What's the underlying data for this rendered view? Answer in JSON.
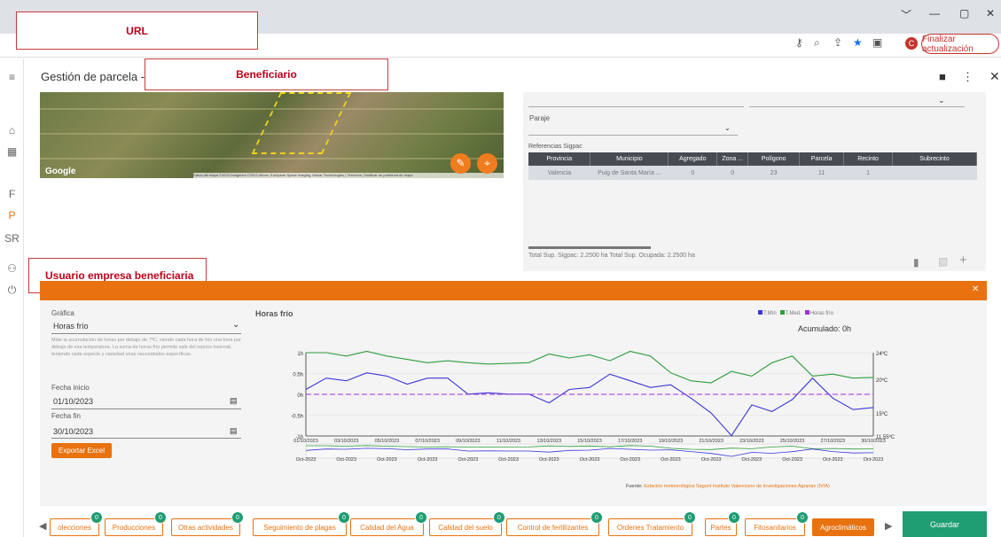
{
  "annotations": {
    "url": "URL",
    "beneficiario": "Beneficiario",
    "usuario": "Usuario empresa beneficiaria"
  },
  "browser": {
    "update_button": "Finalizar actualización",
    "avatar_letter": "C"
  },
  "leftnav": {
    "items": [
      "F",
      "P",
      "SR"
    ]
  },
  "app": {
    "title": "Gestión de parcela -"
  },
  "map": {
    "google": "Google",
    "attribution": "Datos del mapa ©2023 Imágenes ©2023 Airbus, European Space Imaging, Maxar Technologies | Términos | Notificar un problema de maps"
  },
  "right": {
    "paraje_label": "Paraje",
    "ref_label": "Referencias Sigpac",
    "columns": [
      "Provincia",
      "Municipio",
      "Agregado",
      "Zona ...",
      "Polígono",
      "Parcela",
      "Recinto",
      "Subrecinto"
    ],
    "row": [
      "Valencia",
      "Puig de Santa María ...",
      "0",
      "0",
      "23",
      "11",
      "1",
      ""
    ],
    "summary": "Total Sup. Sigpac: 2.2500 ha   Total Sup. Ocupada: 2.2500 ha"
  },
  "form": {
    "grafica_label": "Gráfica",
    "grafica_value": "Horas frío",
    "description": "Mide la acumulación de horas por debajo de 7ºC, siendo cada hora de frío una hora por debajo de esa temperatura. La suma de horas frío permite salir del reposo invernal, teniendo cada especie y variedad unas necesidades específicas.",
    "inicio_label": "Fecha inicio",
    "inicio_value": "01/10/2023",
    "fin_label": "Fecha fin",
    "fin_value": "30/10/2023",
    "export_label": "Exportar Excel"
  },
  "chart_data": {
    "type": "line",
    "title": "Horas frío",
    "accumulated": "Acumulado: 0h",
    "legend": [
      {
        "name": "T.Mín",
        "color": "#3a36d8"
      },
      {
        "name": "T.Med.",
        "color": "#2e9d3b"
      },
      {
        "name": "Horas frío",
        "color": "#a42fd6"
      }
    ],
    "y_left_ticks": [
      "1h",
      "0.5h",
      "0h",
      "-0.5h",
      "-1h"
    ],
    "y_left_range": [
      -1,
      1
    ],
    "y_right_ticks": [
      "24ºC",
      "20ºC",
      "15ºC",
      "11.55ºC"
    ],
    "y_right_range": [
      11.55,
      24
    ],
    "x_ticks": [
      "01/10/2023",
      "03/10/2023",
      "05/10/2023",
      "07/10/2023",
      "09/10/2023",
      "11/10/2023",
      "13/10/2023",
      "15/10/2023",
      "17/10/2023",
      "19/10/2023",
      "21/10/2023",
      "23/10/2023",
      "25/10/2023",
      "27/10/2023",
      "30/10/2023"
    ],
    "nav_ticks": [
      "Oct-2023",
      "Oct-2023",
      "Oct-2023",
      "Oct-2023",
      "Oct-2023",
      "Oct-2023",
      "Oct-2023",
      "Oct-2023",
      "Oct-2023",
      "Oct-2023",
      "Oct-2023",
      "Oct-2023",
      "Oct-2023",
      "Oct-2023",
      "Oct-2023"
    ],
    "series": [
      {
        "name": "T.Med.",
        "values": [
          24,
          24,
          23.5,
          24.2,
          23.5,
          23,
          22.5,
          22.8,
          22.5,
          22.3,
          22.4,
          22.5,
          23.8,
          23.2,
          23.7,
          22.8,
          24.2,
          23.5,
          21,
          19.8,
          19.5,
          21.2,
          20.5,
          22.5,
          23.5,
          20.5,
          20.8,
          20.2,
          20.3
        ]
      },
      {
        "name": "T.Mín",
        "values": [
          18.5,
          20.2,
          19.8,
          21,
          20.5,
          19.3,
          20.2,
          20.2,
          17.8,
          18,
          17.8,
          17.8,
          16.5,
          18.5,
          18.8,
          20.8,
          19.8,
          18.8,
          19.2,
          17.2,
          15,
          11.6,
          16.2,
          15.2,
          17,
          20.2,
          17.2,
          15.5,
          15.8
        ]
      },
      {
        "name": "Horas frío",
        "values": [
          0,
          0,
          0,
          0,
          0,
          0,
          0,
          0,
          0,
          0,
          0,
          0,
          0,
          0,
          0,
          0,
          0,
          0,
          0,
          0,
          0,
          0,
          0,
          0,
          0,
          0,
          0,
          0,
          0
        ]
      }
    ],
    "source_prefix": "Fuente:",
    "source_text": "Estación meteorológica Sagunt Instituto Valenciano de Investigaciones Agrarias (IVIA)"
  },
  "tabs": [
    {
      "label": "olecciones",
      "badge": "0"
    },
    {
      "label": "Producciones",
      "badge": "0"
    },
    {
      "label": "Otras actividades",
      "badge": "0"
    },
    {
      "label": "Seguimiento de plagas",
      "badge": "0"
    },
    {
      "label": "Calidad del Agua",
      "badge": "0"
    },
    {
      "label": "Calidad del suelo",
      "badge": "0"
    },
    {
      "label": "Control de fertilizantes",
      "badge": "0"
    },
    {
      "label": "Ordenes Tratamiento",
      "badge": "0"
    },
    {
      "label": "Partes",
      "badge": "0"
    },
    {
      "label": "Fitosanitarios",
      "badge": "0"
    },
    {
      "label": "Agroclimáticos",
      "badge": ""
    }
  ],
  "save_label": "Guardar"
}
